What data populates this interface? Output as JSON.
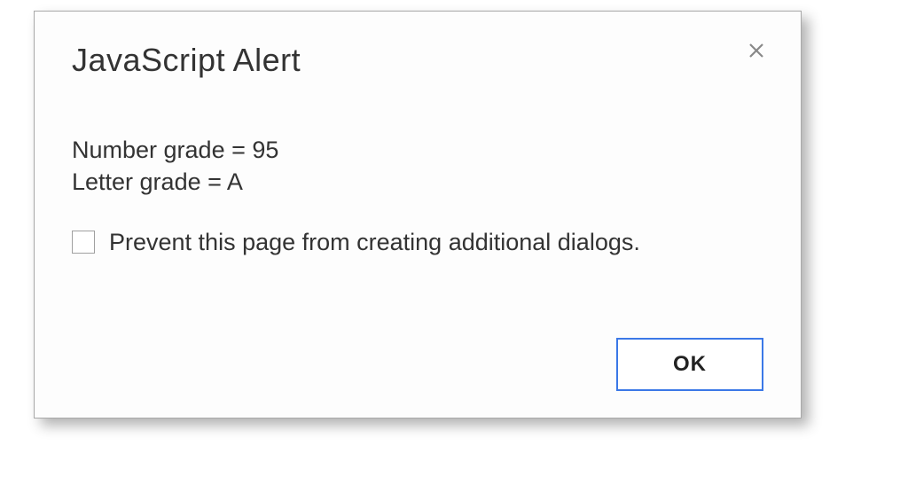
{
  "dialog": {
    "title": "JavaScript Alert",
    "message": {
      "line1": "Number grade = 95",
      "line2": "Letter grade = A"
    },
    "prevent_label": "Prevent this page from creating additional dialogs.",
    "ok_label": "OK"
  }
}
